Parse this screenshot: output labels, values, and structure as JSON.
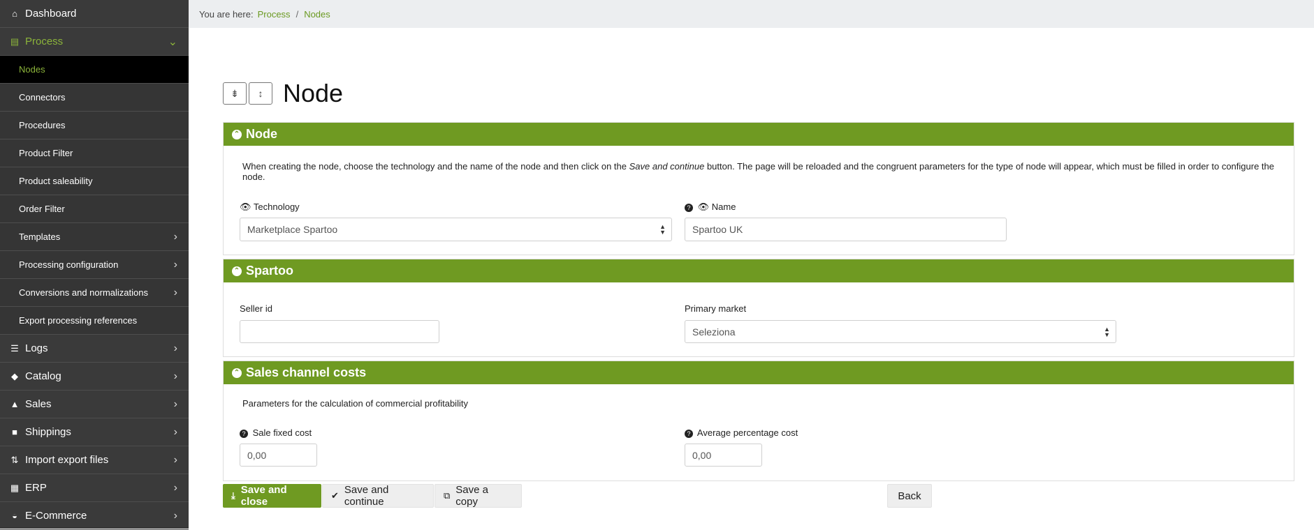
{
  "sidebar": {
    "items": [
      {
        "label": "Dashboard",
        "icon": "home-icon",
        "glyph": "⌂"
      },
      {
        "label": "Process",
        "icon": "process-icon",
        "glyph": "▤"
      },
      {
        "label": "Nodes"
      },
      {
        "label": "Connectors"
      },
      {
        "label": "Procedures"
      },
      {
        "label": "Product Filter"
      },
      {
        "label": "Product saleability"
      },
      {
        "label": "Order Filter"
      },
      {
        "label": "Templates"
      },
      {
        "label": "Processing configuration"
      },
      {
        "label": "Conversions and normalizations"
      },
      {
        "label": "Export processing references"
      },
      {
        "label": "Logs",
        "icon": "logs-icon",
        "glyph": "☰"
      },
      {
        "label": "Catalog",
        "icon": "box-icon",
        "glyph": "◆"
      },
      {
        "label": "Sales",
        "icon": "chart-icon",
        "glyph": "▲"
      },
      {
        "label": "Shippings",
        "icon": "truck-icon",
        "glyph": "■"
      },
      {
        "label": "Import export files",
        "icon": "import-export-icon",
        "glyph": "⇅"
      },
      {
        "label": "ERP",
        "icon": "erp-icon",
        "glyph": "▦"
      },
      {
        "label": "E-Commerce",
        "icon": "basket-icon",
        "glyph": "◒"
      }
    ]
  },
  "breadcrumb": {
    "prefix": "You are here:",
    "items": [
      "Process",
      "Nodes"
    ],
    "separator": "/"
  },
  "page": {
    "title": "Node"
  },
  "panels": {
    "node": {
      "title": "Node",
      "description_pre": "When creating the node, choose the technology and the name of the node and then click on the ",
      "description_em": "Save and continue",
      "description_post": " button. The page will be reloaded and the congruent parameters for the type of node will appear, which must be filled in order to configure the node.",
      "technology_label": "Technology",
      "technology_value": "Marketplace Spartoo",
      "name_label": "Name",
      "name_value": "Spartoo UK"
    },
    "spartoo": {
      "title": "Spartoo",
      "seller_label": "Seller id",
      "seller_value": "",
      "market_label": "Primary market",
      "market_value": "Seleziona"
    },
    "costs": {
      "title": "Sales channel costs",
      "description": "Parameters for the calculation of commercial profitability",
      "fixed_label": "Sale fixed cost",
      "fixed_value": "0,00",
      "avg_label": "Average percentage cost",
      "avg_value": "0,00"
    }
  },
  "buttons": {
    "save_close": "Save and close",
    "save_continue": "Save and continue",
    "save_copy": "Save a copy",
    "back": "Back"
  },
  "colors": {
    "accent": "#6f9a22",
    "sidebar": "#3a3a3a",
    "active_link": "#8bb33a"
  }
}
